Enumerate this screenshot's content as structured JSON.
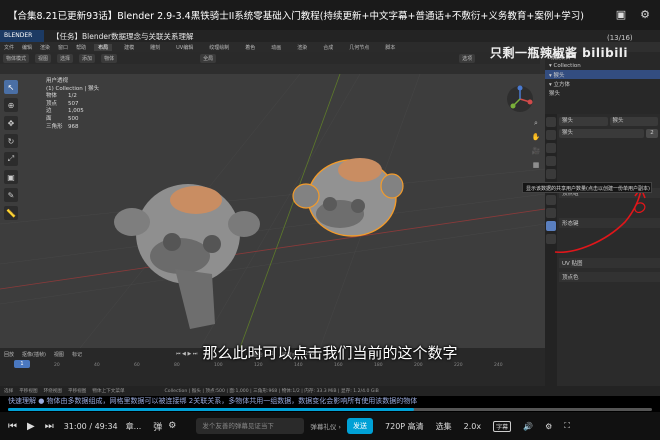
{
  "video": {
    "title": "【合集8.21已更新93话】Blender 2.9-3.4黑铁骑士II系统零基础入门教程(持续更新+中文字幕+普通话+不敷衍+义务教育+案例+学习)",
    "watermark": "只剩一瓶辣椒酱 bilibili",
    "page_count": "(13/16)",
    "subtitle": "那么此时可以点击我们当前的这个数字",
    "danmaku": "快速理解 ● 物体由多数据组成，网格里数据可以被连接绑 2关联关系，多物体共用一组数据，数据变化会影响所有使用该数据的物体",
    "progress": 0.63,
    "current_time": "31:00",
    "total_time": "49:34",
    "time_sep": "/",
    "chapter": "章...",
    "danmaku_placeholder": "发个友善的弹幕见证当下",
    "etiquette": "弹幕礼仪 ›",
    "send": "发送",
    "quality": "720P 高清",
    "select": "选集",
    "speed": "2.0x",
    "cc": "字幕"
  },
  "blender": {
    "logo": "BLENDER 2.9x",
    "notice": "【任务】Blender数据理念与关联关系理解",
    "menu": [
      "文件",
      "编辑",
      "渲染",
      "窗口",
      "帮助"
    ],
    "workspaces": [
      "布局",
      "建模",
      "雕刻",
      "UV编辑",
      "纹理绘制",
      "着色",
      "动画",
      "渲染",
      "合成",
      "几何节点",
      "脚本"
    ],
    "active_workspace": "布局",
    "viewport_header": [
      "物体模式",
      "视图",
      "选择",
      "添加",
      "物体"
    ],
    "tool_header": [
      "全局",
      "选项"
    ],
    "stats": {
      "mode": "用户透视",
      "collection": "(1) Collection | 猴头",
      "rows": [
        {
          "k": "物体",
          "v": "1/2"
        },
        {
          "k": "顶点",
          "v": "507"
        },
        {
          "k": "边",
          "v": "1,005"
        },
        {
          "k": "面",
          "v": "500"
        },
        {
          "k": "三角形",
          "v": "968"
        }
      ]
    },
    "outliner": {
      "rows": [
        {
          "label": "场景集合",
          "sel": false
        },
        {
          "label": "▾ Collection",
          "sel": false
        },
        {
          "label": "  ▾ 猴头",
          "sel": true
        },
        {
          "label": "  ▾ 立方体",
          "sel": false
        },
        {
          "label": "     猴头",
          "sel": false
        }
      ]
    },
    "props": {
      "obj_name": "猴头",
      "mesh_name": "猴头",
      "data_field": "猴头",
      "user_count": "2",
      "sections": [
        "顶点组",
        "形态键",
        "UV 贴图",
        "顶点色"
      ]
    },
    "tooltip": "显示该数据的共享用户数量(点击以创建一份单用户副本)",
    "timeline": {
      "controls": [
        "回放",
        "抠像(插帧)",
        "视图",
        "标记"
      ],
      "frame": "1",
      "start_label": "起始",
      "start": "1",
      "end_label": "结束点",
      "end": "250",
      "ticks": [
        "0",
        "20",
        "40",
        "60",
        "80",
        "100",
        "120",
        "140",
        "160",
        "180",
        "200",
        "220",
        "240"
      ]
    },
    "statusbar": [
      "选择",
      "平移视图",
      "环绕视图",
      "平移视图",
      "物体上下文菜单",
      "Collection | 猴头 | 顶点:500 | 面:1,000 | 三角形:968 | 物体:1/2 | 内存: 33.3 MiB | 显存: 1.2/4.0 GiB"
    ]
  },
  "colors": {
    "accent": "#00a1d6",
    "selection": "#334d80",
    "orange_outline": "#f39b2a",
    "annotation_red": "#e0161a"
  }
}
